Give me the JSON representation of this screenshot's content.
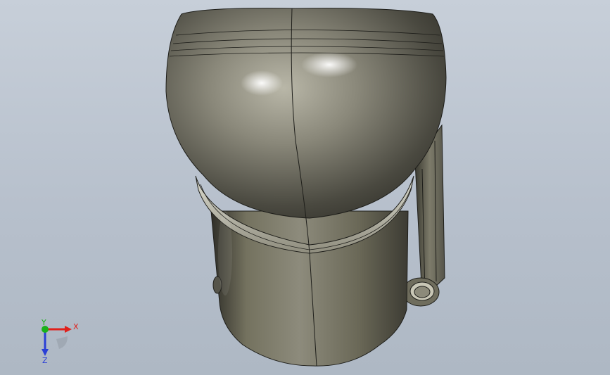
{
  "viewport": {
    "background_top": "#c7cfd9",
    "background_bottom": "#aeb8c4",
    "model_color": "#6e6c60"
  },
  "triad": {
    "x_label": "X",
    "y_label": "Y",
    "z_label": "Z",
    "x_color": "#e0201b",
    "y_color": "#19b219",
    "z_color": "#2a3fd6"
  }
}
